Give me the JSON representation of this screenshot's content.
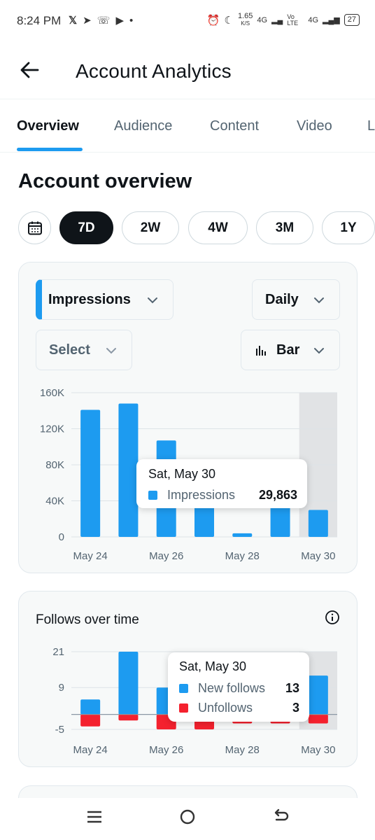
{
  "status_bar": {
    "time": "8:24 PM",
    "app_icons": [
      "x-icon",
      "telegram-icon",
      "whatsapp-icon",
      "youtube-icon",
      "dot-icon"
    ],
    "speed": "1.65",
    "speed_unit": "K/S",
    "net1": "4G",
    "net2": "Vo LTE",
    "net3": "4G",
    "battery": "27"
  },
  "header": {
    "title": "Account Analytics"
  },
  "tabs": [
    {
      "label": "Overview",
      "active": true
    },
    {
      "label": "Audience"
    },
    {
      "label": "Content"
    },
    {
      "label": "Video"
    },
    {
      "label": "L"
    }
  ],
  "section_title": "Account overview",
  "ranges": [
    "7D",
    "2W",
    "4W",
    "3M",
    "1Y"
  ],
  "active_range": "7D",
  "controls": {
    "metric": "Impressions",
    "interval": "Daily",
    "compare": "Select",
    "chart_type": "Bar"
  },
  "chart_data": [
    {
      "type": "bar",
      "categories": [
        "May 24",
        "May 25",
        "May 26",
        "May 27",
        "May 28",
        "May 29",
        "May 30"
      ],
      "x_tick_labels": [
        "May 24",
        "May 26",
        "May 28",
        "May 30"
      ],
      "series": [
        {
          "name": "Impressions",
          "color": "#1d9bf0",
          "values": [
            141000,
            148000,
            107000,
            40000,
            4000,
            40000,
            29863
          ]
        }
      ],
      "y_ticks": [
        "0",
        "40K",
        "80K",
        "120K",
        "160K"
      ],
      "ylim": [
        0,
        160000
      ],
      "grid": true,
      "highlighted_category": "May 30",
      "tooltip": {
        "title": "Sat, May 30",
        "label": "Impressions",
        "value": "29,863"
      }
    },
    {
      "type": "bar",
      "title": "Follows over time",
      "categories": [
        "May 24",
        "May 25",
        "May 26",
        "May 27",
        "May 28",
        "May 29",
        "May 30"
      ],
      "x_tick_labels": [
        "May 24",
        "May 26",
        "May 28",
        "May 30"
      ],
      "series": [
        {
          "name": "New follows",
          "color": "#1d9bf0",
          "values": [
            5,
            21,
            9,
            9,
            9,
            9,
            13
          ]
        },
        {
          "name": "Unfollows",
          "color": "#f4212e",
          "values": [
            -4,
            -2,
            -5,
            -5,
            -3,
            -3,
            -3
          ]
        }
      ],
      "y_ticks": [
        "-5",
        "9",
        "21"
      ],
      "ylim": [
        -5,
        21
      ],
      "grid": true,
      "highlighted_category": "May 30",
      "tooltip": {
        "title": "Sat, May 30",
        "rows": [
          {
            "label": "New follows",
            "value": "13"
          },
          {
            "label": "Unfollows",
            "value": "3"
          }
        ]
      }
    }
  ]
}
